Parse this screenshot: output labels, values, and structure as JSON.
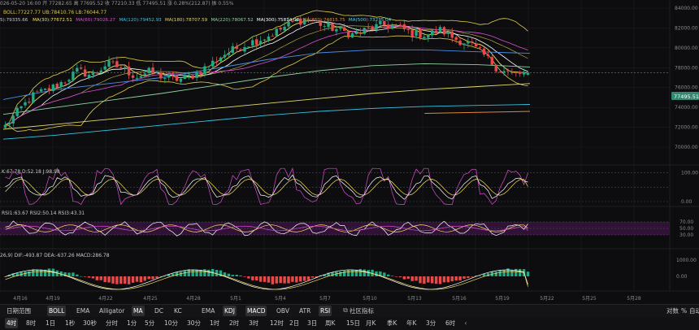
{
  "header": {
    "ohlc_line": "026-05-20 16:00 开 77282.65 高 77695.52 收 77210.33 低 77495.51 涨 0.28%(212.87) 振 0.55%",
    "ma_line_1": "BOLL:77227.77 UB:78410.76 LB:76044.77",
    "ma_line_2": [
      "5):79335.66",
      "MA(30):77672.51",
      "MA(60):79026.27",
      "MA(120):79452.93",
      "MA(180):78707.59",
      "MA(220):78067.52",
      "MA(300):75814.08",
      "MA(360):74815.75",
      "MA(500):73235.04"
    ]
  },
  "colors": {
    "bg": "#0d0d0f",
    "up": "#23a884",
    "down": "#e64a4a",
    "grid": "#1d1d21",
    "ma5": "#f5e062",
    "ma30": "#ffffff",
    "ma60": "#d84fd0",
    "ma120": "#39c3df",
    "ma180": "#e0d86a",
    "ma220": "#8fd3a3",
    "ma300": "#ffd18a",
    "ma360": "#e35b5b",
    "ma500": "#5ad0e6",
    "boll": "#e3cf45",
    "price_tag": "#2e8a70",
    "rsi_band": "#3a1440"
  },
  "price_axis": [
    "84000.00",
    "82000.00",
    "80000.00",
    "78000.00",
    "76000.00",
    "74000.00",
    "72000.00",
    "70000.00"
  ],
  "price_tag": "77495.51",
  "kdj": {
    "label": "K:67.78 D:52.18 J:98.98",
    "axis": [
      "100.00",
      "0.00"
    ]
  },
  "rsi": {
    "label": "RSI1:63.67 RSI2:50.14 RSI3:43.31",
    "axis": [
      "70.00",
      "50.00",
      "30.00"
    ]
  },
  "macd": {
    "label": "26,9) DIF:-493.87 DEA:-637.26 MACD:286.78",
    "axis": [
      "1000.00",
      "0.00"
    ]
  },
  "date_axis": [
    "4月16",
    "4月19",
    "4月22",
    "4月25",
    "4月28",
    "5月1",
    "5月4",
    "5月7",
    "5月10",
    "5月13",
    "5月16",
    "5月19",
    "5月22",
    "5月25",
    "5月28"
  ],
  "toolbar_indicators": [
    {
      "label": "日期范围",
      "active": false
    },
    {
      "label": "BOLL",
      "active": true
    },
    {
      "label": "EMA",
      "active": false
    },
    {
      "label": "Alligator",
      "active": false
    },
    {
      "label": "MA",
      "active": true
    },
    {
      "label": "DC",
      "active": false
    },
    {
      "label": "KC",
      "active": false
    },
    {
      "label": "EMA",
      "active": false
    },
    {
      "label": "KDJ",
      "active": true
    },
    {
      "label": "MACD",
      "active": true
    },
    {
      "label": "OBV",
      "active": false
    },
    {
      "label": "ATR",
      "active": false
    },
    {
      "label": "RSI",
      "active": true
    },
    {
      "label": "社区指标",
      "active": false
    }
  ],
  "toolbar_right": [
    "对数",
    "%",
    "自动"
  ],
  "intervals": [
    {
      "label": "4时",
      "active": true
    },
    {
      "label": "8时",
      "active": false
    },
    {
      "label": "1日",
      "active": false
    },
    {
      "label": "1秒",
      "active": false
    },
    {
      "label": "30秒",
      "active": false
    },
    {
      "label": "分时",
      "active": false
    },
    {
      "label": "1分",
      "active": false
    },
    {
      "label": "5分",
      "active": false
    },
    {
      "label": "10分",
      "active": false
    },
    {
      "label": "30分",
      "active": false
    },
    {
      "label": "1时",
      "active": false
    },
    {
      "label": "2时",
      "active": false
    },
    {
      "label": "3时",
      "active": false
    },
    {
      "label": "12时",
      "active": false
    },
    {
      "label": "2日",
      "active": false
    },
    {
      "label": "3日",
      "active": false
    },
    {
      "label": "周K",
      "active": false
    },
    {
      "label": "15日",
      "active": false
    },
    {
      "label": "月K",
      "active": false
    },
    {
      "label": "季K",
      "active": false
    },
    {
      "label": "年K",
      "active": false
    },
    {
      "label": "3分",
      "active": false
    },
    {
      "label": "6时",
      "active": false
    }
  ],
  "chart_data": {
    "type": "candlestick",
    "x": [
      "4月16",
      "5月22"
    ],
    "ylim": [
      69000,
      85000
    ],
    "y_axis_ticks": [
      84000,
      82000,
      80000,
      78000,
      76000,
      74000,
      72000,
      70000
    ],
    "close_anchors_by_day": [
      [
        0,
        72100
      ],
      [
        1,
        73800
      ],
      [
        2,
        75300
      ],
      [
        3,
        75800
      ],
      [
        4,
        76600
      ],
      [
        5,
        77700
      ],
      [
        6,
        77200
      ],
      [
        7,
        78400
      ],
      [
        8,
        78000
      ],
      [
        9,
        77100
      ],
      [
        10,
        77600
      ],
      [
        11,
        77000
      ],
      [
        12,
        76800
      ],
      [
        13,
        77300
      ],
      [
        14,
        78200
      ],
      [
        15,
        79300
      ],
      [
        16,
        80000
      ],
      [
        17,
        80600
      ],
      [
        18,
        81100
      ],
      [
        19,
        81900
      ],
      [
        20,
        82700
      ],
      [
        21,
        82900
      ],
      [
        22,
        82200
      ],
      [
        23,
        81800
      ],
      [
        24,
        81300
      ],
      [
        25,
        81900
      ],
      [
        26,
        82300
      ],
      [
        27,
        82100
      ],
      [
        28,
        81500
      ],
      [
        29,
        81300
      ],
      [
        30,
        81800
      ],
      [
        31,
        80900
      ],
      [
        32,
        80400
      ],
      [
        33,
        79200
      ],
      [
        34,
        77800
      ],
      [
        35,
        77300
      ],
      [
        36,
        77500
      ]
    ],
    "last_close": 77495.51,
    "last_open": 77282.65,
    "last_high": 77695.52,
    "last_low": 77210.33,
    "change_pct": 0.28,
    "series": [
      {
        "name": "MA(500)",
        "values": [
          70800,
          71200,
          71700,
          72200,
          72700,
          73200,
          73600,
          73900,
          74100,
          74200,
          74300
        ]
      },
      {
        "name": "MA(360)",
        "values": [
          71800,
          72300,
          72800,
          73300,
          73900,
          74400,
          74900,
          75400,
          75800,
          76100,
          76400
        ]
      },
      {
        "name": "MA(300)",
        "values": [
          null,
          null,
          null,
          null,
          null,
          null,
          null,
          null,
          73400,
          73500,
          73600
        ]
      },
      {
        "name": "MA(220)",
        "values": [
          73300,
          74000,
          74700,
          75400,
          76200,
          77000,
          77700,
          78200,
          78400,
          78300,
          78070
        ]
      },
      {
        "name": "MA(120)",
        "values": [
          74800,
          75800,
          76400,
          77000,
          77900,
          78800,
          79500,
          79800,
          79800,
          79600,
          79450
        ]
      }
    ],
    "indicators": {
      "KDJ": {
        "K": 67.78,
        "D": 52.18,
        "J": 98.98
      },
      "RSI": {
        "RSI1": 63.67,
        "RSI2": 50.14,
        "RSI3": 43.31
      },
      "MACD": {
        "DIF": -493.87,
        "DEA": -637.26,
        "MACD": 286.78
      }
    }
  }
}
